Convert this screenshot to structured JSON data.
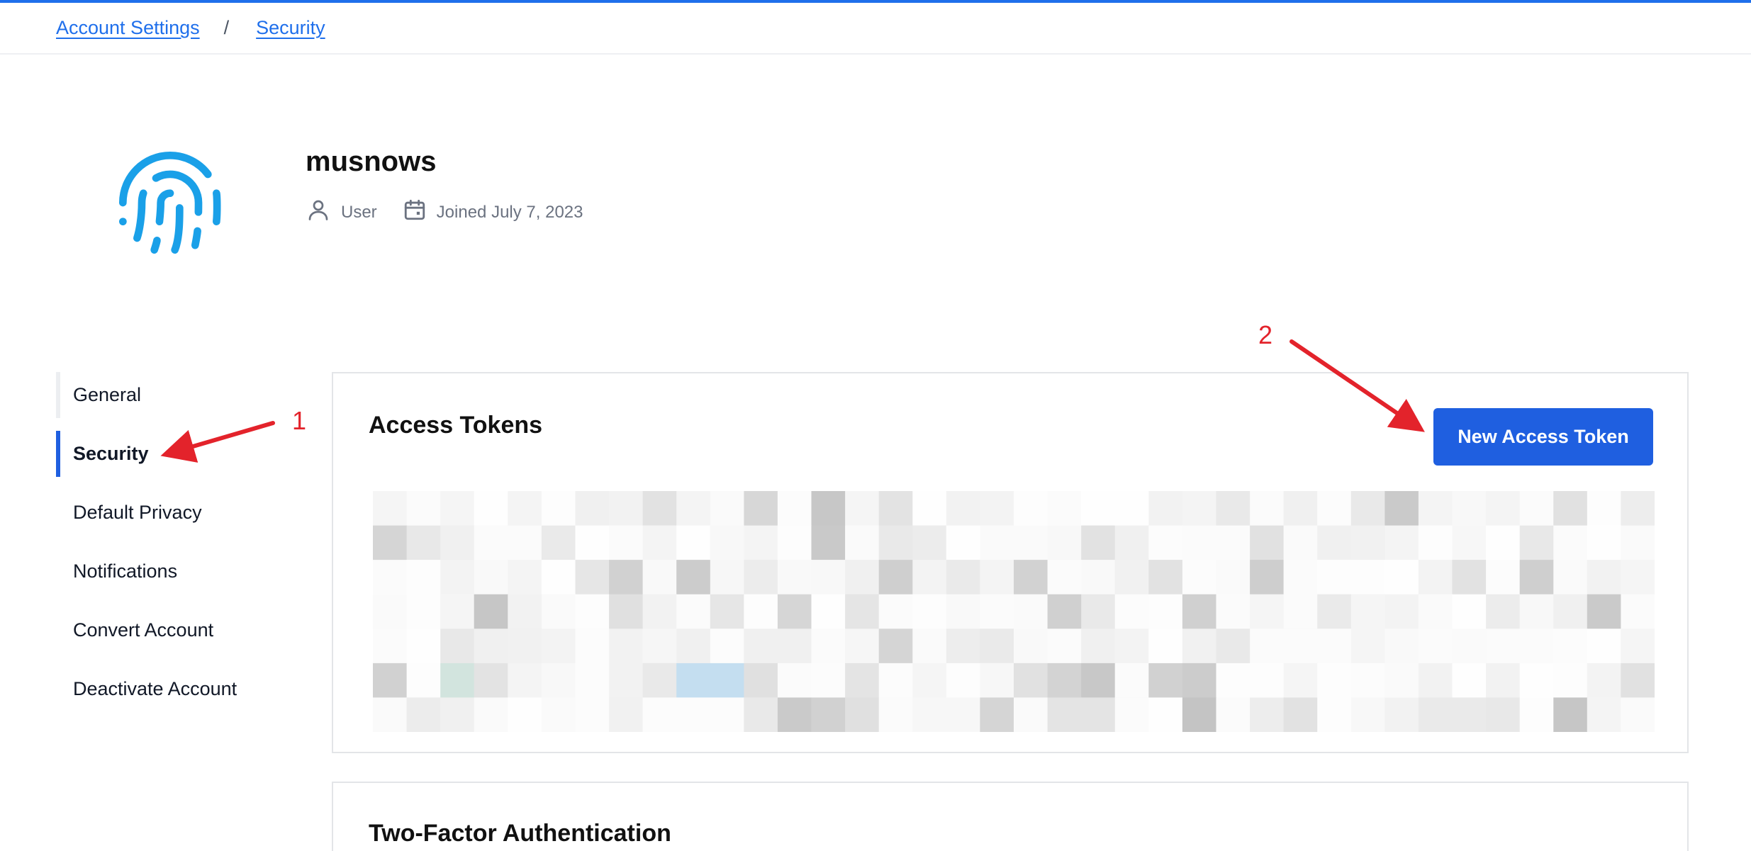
{
  "breadcrumb": {
    "parent": "Account Settings",
    "separator": "/",
    "current": "Security"
  },
  "profile": {
    "username": "musnows",
    "role": "User",
    "joined": "Joined July 7, 2023",
    "avatar_icon": "fingerprint-icon",
    "avatar_color": "#1aa0e8"
  },
  "sidebar": {
    "items": [
      {
        "label": "General"
      },
      {
        "label": "Security"
      },
      {
        "label": "Default Privacy"
      },
      {
        "label": "Notifications"
      },
      {
        "label": "Convert Account"
      },
      {
        "label": "Deactivate Account"
      }
    ]
  },
  "tokens_card": {
    "title": "Access Tokens",
    "button_label": "New Access Token"
  },
  "twofa_card": {
    "title": "Two-Factor Authentication"
  },
  "annotations": {
    "marker_1": "1",
    "marker_2": "2",
    "color": "#e3232b"
  },
  "colors": {
    "accent": "#1f5fe0",
    "link": "#1f6feb"
  }
}
